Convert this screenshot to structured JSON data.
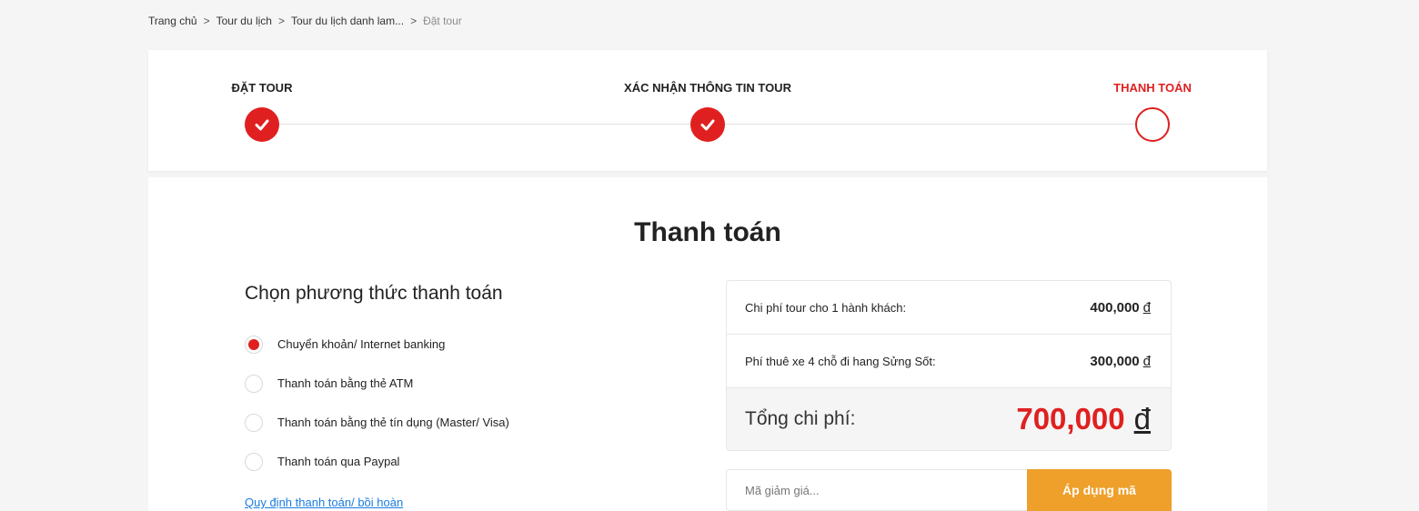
{
  "breadcrumb": {
    "items": [
      "Trang chủ",
      "Tour du lịch",
      "Tour du lịch danh lam...",
      "Đặt tour"
    ],
    "separator": ">"
  },
  "steps": [
    {
      "label": "ĐẶT TOUR",
      "state": "done"
    },
    {
      "label": "XÁC NHẬN THÔNG TIN TOUR",
      "state": "done"
    },
    {
      "label": "THANH TOÁN",
      "state": "current"
    }
  ],
  "page": {
    "title": "Thanh toán"
  },
  "payment": {
    "title": "Chọn phương thức thanh toán",
    "methods": [
      {
        "label": "Chuyển khoản/ Internet banking",
        "selected": true
      },
      {
        "label": "Thanh toán bằng thẻ ATM",
        "selected": false
      },
      {
        "label": "Thanh toán bằng thẻ tín dụng (Master/ Visa)",
        "selected": false
      },
      {
        "label": "Thanh toán qua Paypal",
        "selected": false
      }
    ],
    "policy_link": "Quy định thanh toán/ bồi hoàn"
  },
  "summary": {
    "rows": [
      {
        "label": "Chi phí tour cho 1 hành khách:",
        "amount": "400,000",
        "currency": "đ"
      },
      {
        "label": "Phí thuê xe 4 chỗ đi hang Sửng Sốt:",
        "amount": "300,000",
        "currency": "đ"
      }
    ],
    "total_label": "Tổng chi phí:",
    "total_amount": "700,000",
    "total_currency": "đ"
  },
  "coupon": {
    "placeholder": "Mã giảm giá...",
    "button_label": "Áp dụng mã"
  },
  "colors": {
    "accent": "#e02020",
    "button": "#eea02b",
    "link": "#1a7de0"
  },
  "icons": {
    "done": "check-icon"
  }
}
